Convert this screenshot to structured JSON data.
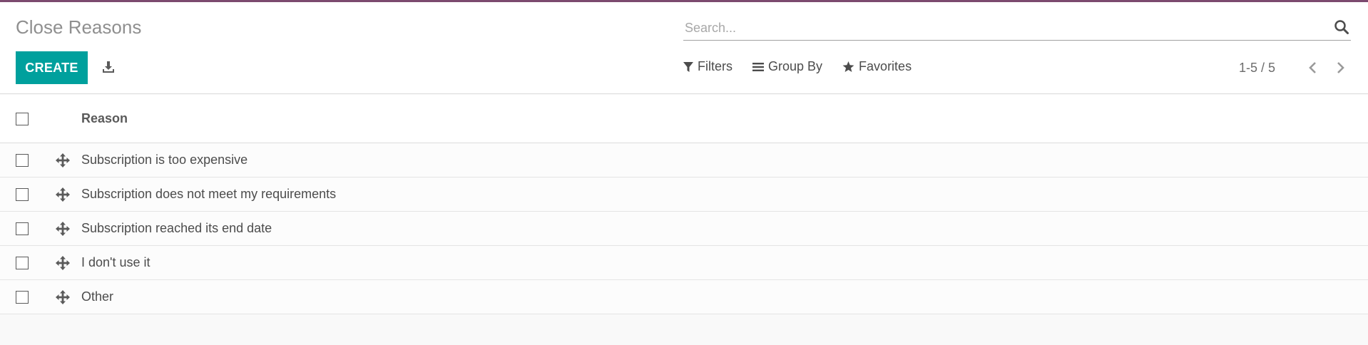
{
  "header": {
    "title": "Close Reasons",
    "create_label": "CREATE",
    "download_icon": "download-icon"
  },
  "search": {
    "placeholder": "Search...",
    "value": "",
    "icon": "search-icon"
  },
  "filters": {
    "filters_label": "Filters",
    "group_by_label": "Group By",
    "favorites_label": "Favorites"
  },
  "pager": {
    "value": "1-5 / 5"
  },
  "table": {
    "columns": [
      "Reason"
    ],
    "rows": [
      {
        "reason": "Subscription is too expensive"
      },
      {
        "reason": "Subscription does not meet my requirements"
      },
      {
        "reason": "Subscription reached its end date"
      },
      {
        "reason": "I don't use it"
      },
      {
        "reason": "Other"
      }
    ]
  },
  "colors": {
    "primary": "#00a09d",
    "accent_bar": "#7c4a6f",
    "text": "#4c4c4c",
    "title": "#8f8f8f"
  }
}
